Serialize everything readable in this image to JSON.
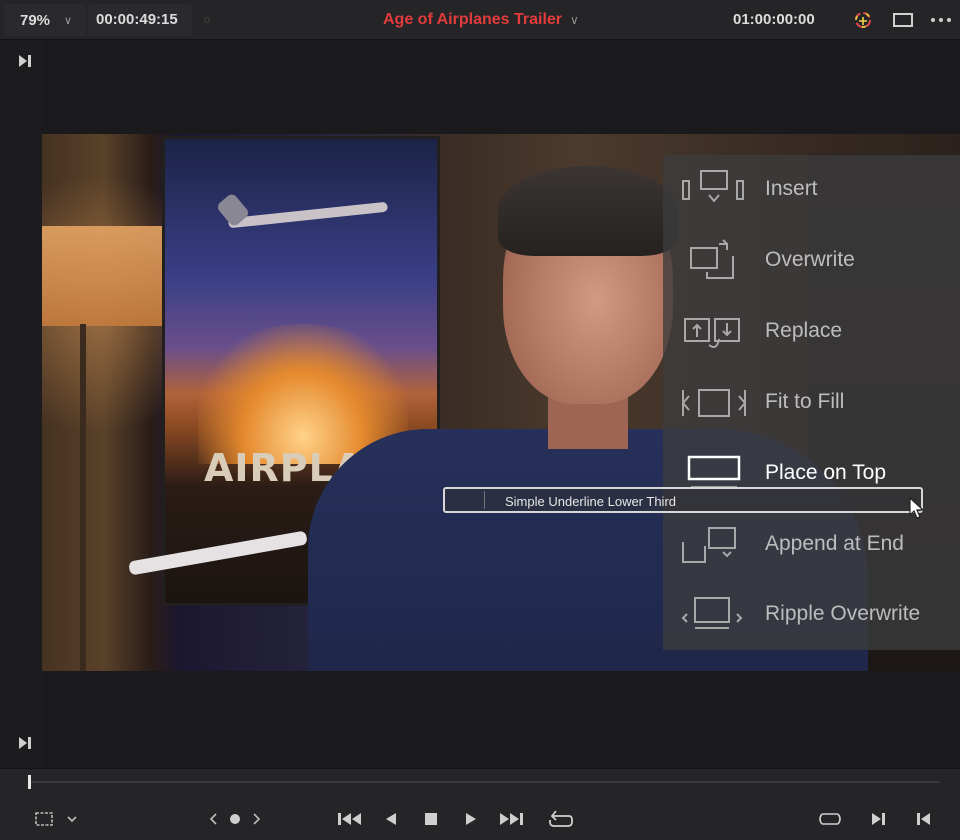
{
  "topbar": {
    "zoom_level": "79%",
    "source_timecode": "00:00:49:15",
    "timeline_title": "Age of Airplanes Trailer",
    "record_timecode": "01:00:00:00",
    "icons": [
      "chevron-down-icon",
      "color-wheel-icon",
      "viewer-size-icon",
      "more-options-icon"
    ]
  },
  "viewer": {
    "poster_text": "AIRPLANES"
  },
  "edit_overlay": {
    "options": [
      {
        "label": "Insert",
        "icon": "insert-icon"
      },
      {
        "label": "Overwrite",
        "icon": "overwrite-icon"
      },
      {
        "label": "Replace",
        "icon": "replace-icon"
      },
      {
        "label": "Fit to Fill",
        "icon": "fit-to-fill-icon"
      },
      {
        "label": "Place on Top",
        "icon": "place-on-top-icon",
        "active": true
      },
      {
        "label": "Append at End",
        "icon": "append-at-end-icon"
      },
      {
        "label": "Ripple Overwrite",
        "icon": "ripple-overwrite-icon"
      }
    ],
    "dragged_clip": "Simple Underline Lower Third"
  },
  "transport": {
    "playhead_position": 0.0,
    "icons": [
      "safe-area-icon",
      "jog-control-icon",
      "go-to-start-icon",
      "play-reverse-icon",
      "stop-icon",
      "play-icon",
      "go-to-end-icon",
      "loop-icon",
      "match-frame-icon",
      "mark-out-icon",
      "mark-in-icon"
    ]
  },
  "colors": {
    "title_red": "#e23b3b",
    "overlay_bg": "#3c3c3e",
    "bar_bg": "#252528"
  }
}
